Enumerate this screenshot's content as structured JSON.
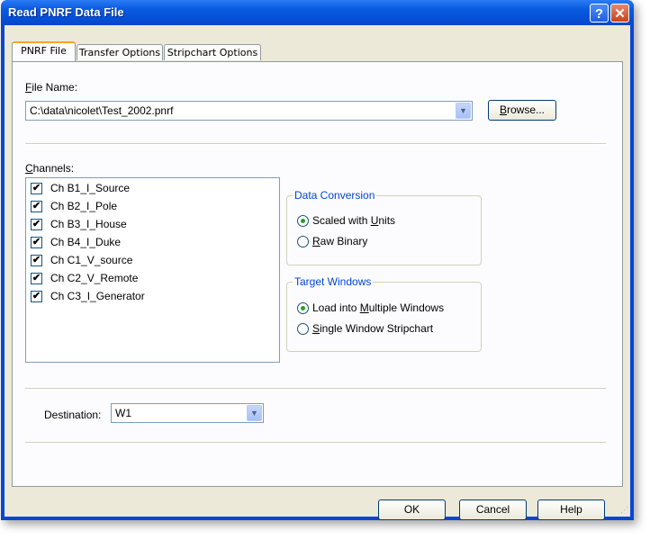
{
  "window": {
    "title": "Read PNRF Data File",
    "help_glyph": "?",
    "close_glyph": "✕"
  },
  "tabs": [
    "PNRF File",
    "Transfer Options",
    "Stripchart Options"
  ],
  "file": {
    "label_mnemonic": "F",
    "label_rest": "ile Name:",
    "value": "C:\\data\\nicolet\\Test_2002.pnrf",
    "browse_mnemonic": "B",
    "browse_rest": "rowse..."
  },
  "channels": {
    "label_mnemonic": "C",
    "label_rest": "hannels:",
    "items": [
      {
        "label": "Ch B1_I_Source",
        "checked": true
      },
      {
        "label": "Ch B2_I_Pole",
        "checked": true
      },
      {
        "label": "Ch B3_I_House",
        "checked": true
      },
      {
        "label": "Ch B4_I_Duke",
        "checked": true
      },
      {
        "label": "Ch C1_V_source",
        "checked": true
      },
      {
        "label": "Ch C2_V_Remote",
        "checked": true
      },
      {
        "label": "Ch C3_I_Generator",
        "checked": true
      }
    ]
  },
  "data_conversion": {
    "title": "Data Conversion",
    "option1": {
      "pre": "Scaled with ",
      "mnemonic": "U",
      "post": "nits",
      "selected": true
    },
    "option2": {
      "pre": "",
      "mnemonic": "R",
      "post": "aw Binary",
      "selected": false
    }
  },
  "target_windows": {
    "title": "Target Windows",
    "option1": {
      "pre": "Load into ",
      "mnemonic": "M",
      "post": "ultiple Windows",
      "selected": true
    },
    "option2": {
      "pre": "",
      "mnemonic": "S",
      "post": "ingle Window Stripchart",
      "selected": false
    }
  },
  "destination": {
    "label": "Destination:",
    "value": "W1"
  },
  "buttons": {
    "ok": "OK",
    "cancel": "Cancel",
    "help": "Help"
  },
  "check_glyph": "✔",
  "dropdown_glyph": "▼"
}
